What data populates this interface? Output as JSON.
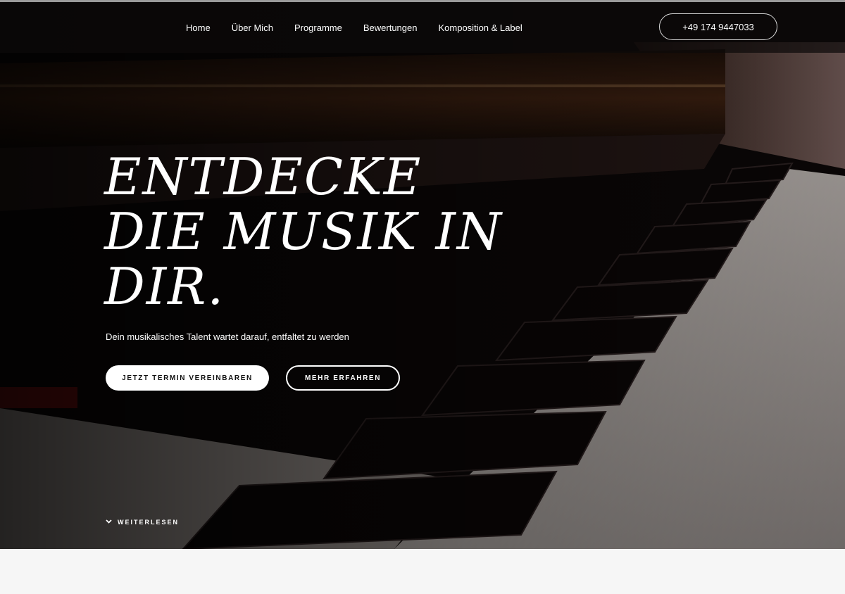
{
  "nav": {
    "links": [
      "Home",
      "Über Mich",
      "Programme",
      "Bewertungen",
      "Komposition & Label"
    ],
    "phone": "+49 174 9447033"
  },
  "hero": {
    "headline_lines": [
      "ENTDECKE",
      "DIE MUSIK IN",
      "DIR."
    ],
    "subline": "Dein musikalisches Talent wartet darauf, entfaltet zu werden",
    "primary_button": "JETZT TERMIN VEREINBAREN",
    "secondary_button": "MEHR ERFAHREN",
    "read_more": "WEITERLESEN",
    "background": "piano-keys-photo"
  },
  "colors": {
    "accent": "#ffffff",
    "navbar_bg": "#0c0a0a",
    "page_bg": "#f6f6f6"
  }
}
